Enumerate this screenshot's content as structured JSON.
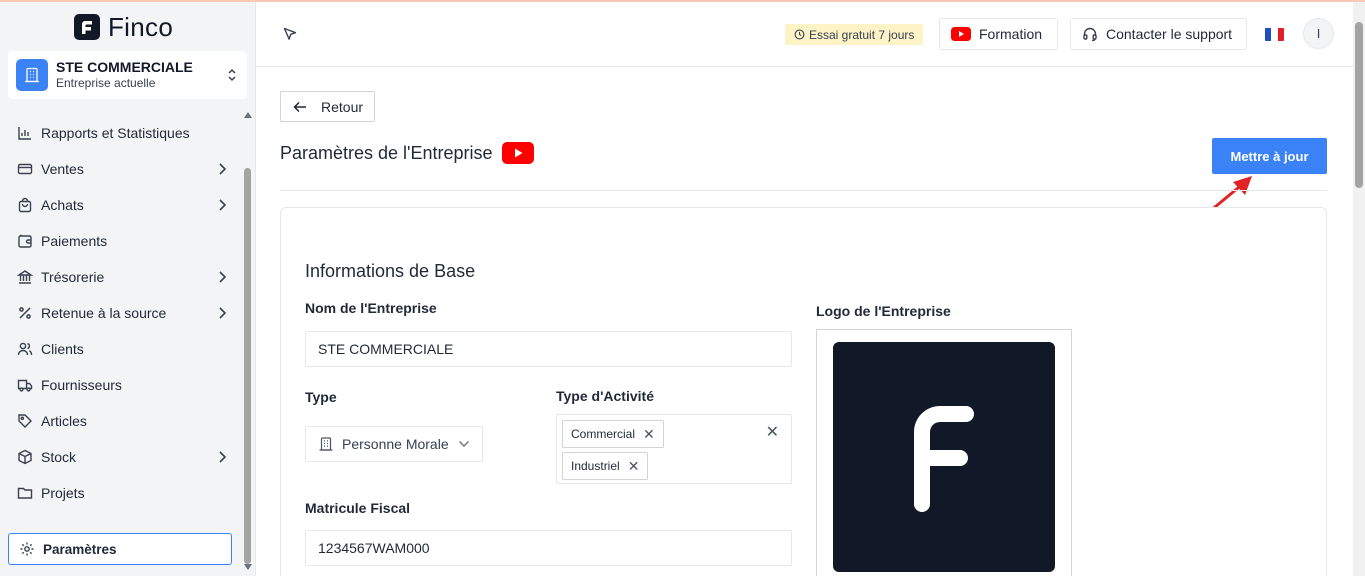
{
  "app": {
    "brand": "Finco"
  },
  "sidebar": {
    "company": {
      "name": "STE COMMERCIALE",
      "subtitle": "Entreprise actuelle"
    },
    "items": [
      {
        "label": "Rapports et Statistiques",
        "icon": "bar-chart-icon",
        "has_submenu": false
      },
      {
        "label": "Ventes",
        "icon": "card-icon",
        "has_submenu": true
      },
      {
        "label": "Achats",
        "icon": "shopping-bag-icon",
        "has_submenu": true
      },
      {
        "label": "Paiements",
        "icon": "wallet-icon",
        "has_submenu": false
      },
      {
        "label": "Trésorerie",
        "icon": "bank-icon",
        "has_submenu": true
      },
      {
        "label": "Retenue à la source",
        "icon": "percent-icon",
        "has_submenu": true
      },
      {
        "label": "Clients",
        "icon": "users-icon",
        "has_submenu": false
      },
      {
        "label": "Fournisseurs",
        "icon": "truck-icon",
        "has_submenu": false
      },
      {
        "label": "Articles",
        "icon": "tag-icon",
        "has_submenu": false
      },
      {
        "label": "Stock",
        "icon": "box-icon",
        "has_submenu": true
      },
      {
        "label": "Projets",
        "icon": "folder-icon",
        "has_submenu": false
      }
    ],
    "settings_label": "Paramètres"
  },
  "header": {
    "trial": "Essai gratuit 7 jours",
    "formation": "Formation",
    "support": "Contacter le support",
    "avatar": "I"
  },
  "main": {
    "back_label": "Retour",
    "page_title": "Paramètres de l'Entreprise",
    "update_label": "Mettre à jour",
    "section_title": "Informations de Base",
    "company_name_label": "Nom de l'Entreprise",
    "company_name_value": "STE COMMERCIALE",
    "type_label": "Type",
    "type_value": "Personne Morale",
    "activity_label": "Type d'Activité",
    "activity_tags": [
      "Commercial",
      "Industriel"
    ],
    "tax_id_label": "Matricule Fiscal",
    "tax_id_value": "1234567WAM000",
    "logo_label": "Logo de l'Entreprise"
  },
  "colors": {
    "accent": "#3b82f6",
    "annotation_arrow": "#e02424",
    "youtube_red": "#ff0000",
    "trial_bg": "#fef3c7"
  }
}
